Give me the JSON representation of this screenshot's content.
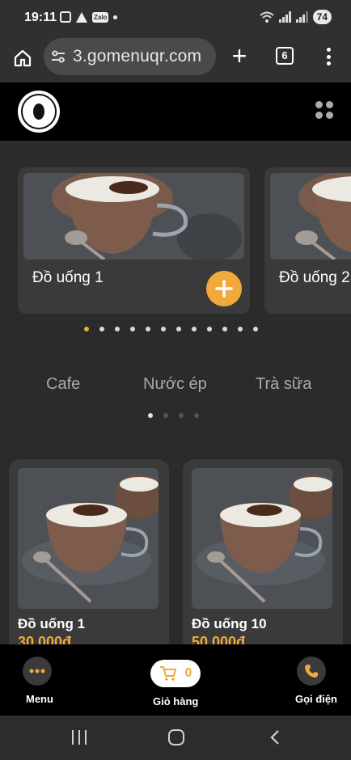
{
  "status_bar": {
    "time": "19:11",
    "zalo_label": "Zalo",
    "battery": "74"
  },
  "browser": {
    "url": "3.gomenuqr.com",
    "tab_count": "6",
    "new_tab_label": "+"
  },
  "carousel": {
    "items": [
      {
        "label": "Đồ uống 1"
      },
      {
        "label": "Đồ uống 2"
      }
    ],
    "dot_count": 12,
    "active_dot": 0
  },
  "categories": {
    "items": [
      "Cafe",
      "Nước ép",
      "Trà sữa"
    ],
    "dot_count": 4,
    "active_dot": 0
  },
  "products": [
    {
      "name": "Đồ uống 1",
      "price": "30.000đ"
    },
    {
      "name": "Đồ uống 10",
      "price": "50.000đ"
    }
  ],
  "app_nav": {
    "menu_label": "Menu",
    "cart_label": "Giỏ hàng",
    "cart_count": "0",
    "call_label": "Gọi điện"
  },
  "colors": {
    "accent": "#f2a93b",
    "background": "#2b2b2b",
    "card": "#3a3a3a"
  }
}
